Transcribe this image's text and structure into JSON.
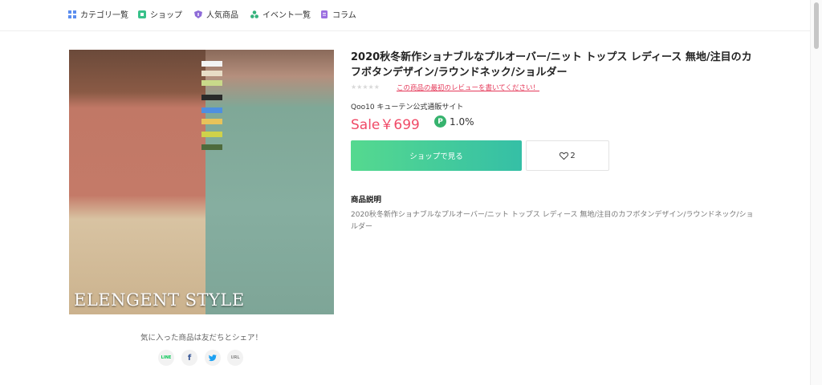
{
  "nav": {
    "items": [
      {
        "label": "カテゴリ一覧",
        "icon": "grid-icon",
        "color": "#5b8def"
      },
      {
        "label": "ショップ",
        "icon": "shop-icon",
        "color": "#38c18a"
      },
      {
        "label": "人気商品",
        "icon": "shield-icon",
        "color": "#8e6bd8"
      },
      {
        "label": "イベント一覧",
        "icon": "triangle-dots-icon",
        "color": "#35b27c"
      },
      {
        "label": "コラム",
        "icon": "document-icon",
        "color": "#9b6ee0"
      }
    ]
  },
  "product": {
    "image_caption": "ELENGENT STYLE",
    "title": "2020秋冬新作ショナブルなプルオーバー/ニット トップス レディース 無地/注目のカフボタンデザイン/ラウンドネック/ショルダー",
    "rating_stars": 0,
    "review_link": "この商品の最初のレビューを書いてください！",
    "seller": "Qoo10 キューテン公式通販サイト",
    "price": "Sale￥699",
    "points_badge": "P",
    "points_rate": "1.0%",
    "shop_button": "ショップで見る",
    "like_count": "2",
    "description_heading": "商品説明",
    "description": "2020秋冬新作ショナブルなプルオーバー/ニット トップス レディース 無地/注目のカフボタンデザイン/ラウンドネック/ショルダー"
  },
  "share": {
    "text": "気に入った商品は友だちとシェア！",
    "buttons": [
      {
        "label": "LINE",
        "icon": "line-icon",
        "color": "#06c755"
      },
      {
        "label": "f",
        "icon": "facebook-icon",
        "color": "#3b5998"
      },
      {
        "label": "",
        "icon": "twitter-icon",
        "color": "#1da1f2"
      },
      {
        "label": "URL",
        "icon": "url-icon",
        "color": "#555555"
      }
    ]
  },
  "colors": {
    "accent_price": "#f04a67",
    "button_gradient_start": "#55d98f",
    "button_gradient_end": "#35bfa6"
  }
}
